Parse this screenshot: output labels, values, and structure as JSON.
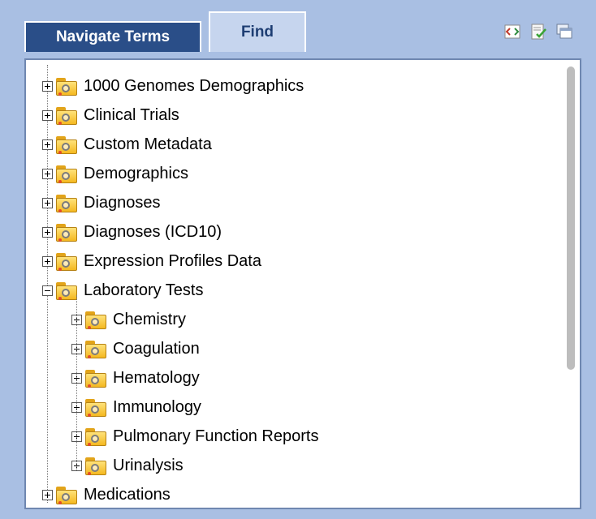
{
  "tabs": {
    "navigate": "Navigate Terms",
    "find": "Find"
  },
  "toolbar": {
    "icons": [
      "code-view-icon",
      "checklist-icon",
      "window-stack-icon"
    ]
  },
  "tree": {
    "items": [
      {
        "label": "1000 Genomes Demographics",
        "expanded": false
      },
      {
        "label": "Clinical Trials",
        "expanded": false
      },
      {
        "label": "Custom Metadata",
        "expanded": false
      },
      {
        "label": "Demographics",
        "expanded": false
      },
      {
        "label": "Diagnoses",
        "expanded": false
      },
      {
        "label": "Diagnoses (ICD10)",
        "expanded": false
      },
      {
        "label": "Expression Profiles Data",
        "expanded": false
      },
      {
        "label": "Laboratory Tests",
        "expanded": true,
        "children": [
          {
            "label": "Chemistry"
          },
          {
            "label": "Coagulation"
          },
          {
            "label": "Hematology"
          },
          {
            "label": "Immunology"
          },
          {
            "label": "Pulmonary Function Reports"
          },
          {
            "label": "Urinalysis"
          }
        ]
      },
      {
        "label": "Medications",
        "expanded": false
      }
    ]
  },
  "colors": {
    "accent": "#2a4e88",
    "background": "#a9bfe3",
    "folder": "#f4b820"
  }
}
